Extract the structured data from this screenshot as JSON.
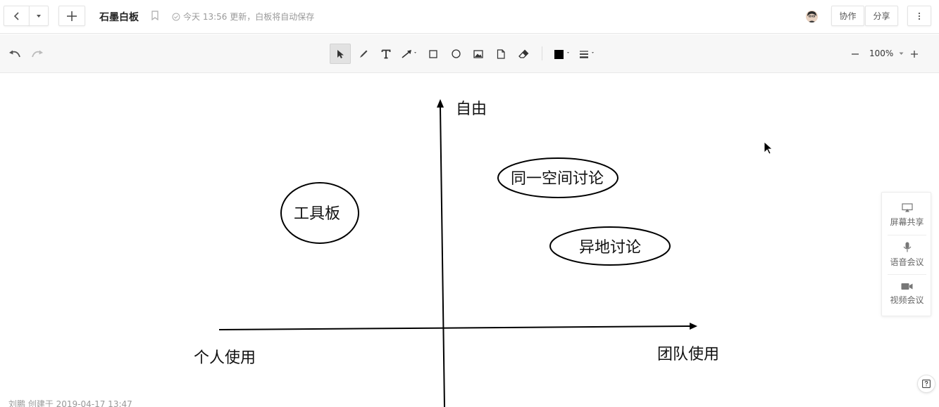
{
  "header": {
    "title": "石墨白板",
    "status": "今天 13:56 更新，白板将自动保存",
    "collaborate_label": "协作",
    "share_label": "分享"
  },
  "toolbar": {
    "zoom_level": "100%",
    "active_tool": "select",
    "stroke_color": "#000000"
  },
  "whiteboard": {
    "axis_y_label": "自由",
    "axis_x_left_label": "个人使用",
    "axis_x_right_label": "团队使用",
    "bubble_1": "工具板",
    "bubble_2": "同一空间讨论",
    "bubble_3": "异地讨论"
  },
  "side_panel": {
    "items": [
      {
        "label": "屏幕共享",
        "icon": "screen-share-icon"
      },
      {
        "label": "语音会议",
        "icon": "microphone-icon"
      },
      {
        "label": "视频会议",
        "icon": "video-camera-icon"
      }
    ]
  },
  "footer": {
    "creator_info": "刘鹏 创建于 2019-04-17 13:47"
  }
}
